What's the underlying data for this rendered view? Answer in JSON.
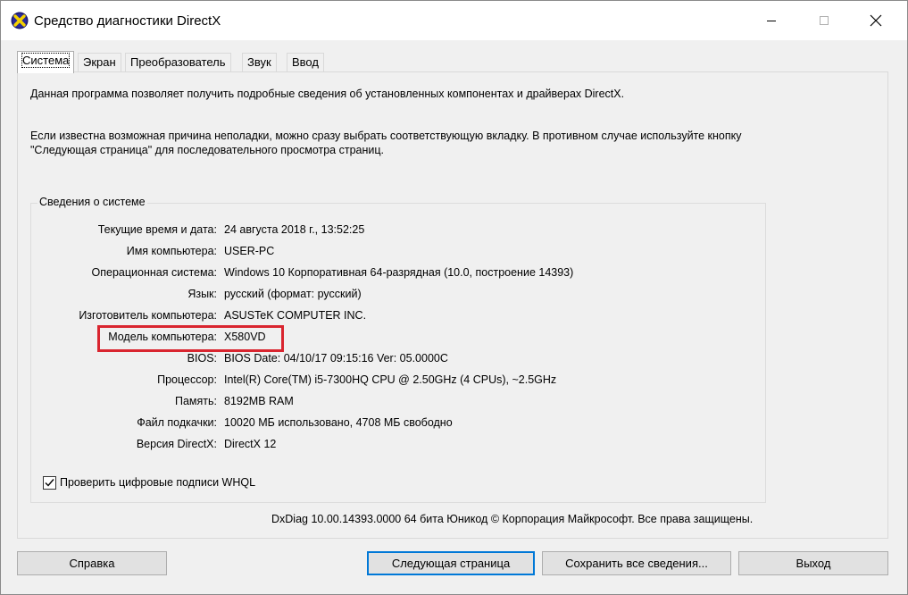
{
  "window": {
    "title": "Средство диагностики DirectX",
    "icon": "directx-icon",
    "controls": {
      "minimize": "minimize-icon",
      "maximize": "maximize-icon",
      "close": "close-icon"
    }
  },
  "tabs": [
    {
      "label": "Система",
      "active": true
    },
    {
      "label": "Экран",
      "active": false
    },
    {
      "label": "Преобразователь",
      "active": false
    },
    {
      "label": "Звук",
      "active": false
    },
    {
      "label": "Ввод",
      "active": false
    }
  ],
  "intro": {
    "line1": "Данная программа позволяет получить подробные сведения об установленных компонентах и драйверах DirectX.",
    "line2": "Если известна возможная причина неполадки, можно сразу выбрать соответствующую вкладку. В противном случае используйте кнопку \"Следующая страница\" для последовательного просмотра страниц."
  },
  "system_info": {
    "group_title": "Сведения о системе",
    "rows": [
      {
        "label": "Текущие время и дата:",
        "value": "24 августа 2018 г., 13:52:25"
      },
      {
        "label": "Имя компьютера:",
        "value": "USER-PC"
      },
      {
        "label": "Операционная система:",
        "value": "Windows 10 Корпоративная 64-разрядная (10.0, построение 14393)"
      },
      {
        "label": "Язык:",
        "value": "русский (формат: русский)"
      },
      {
        "label": "Изготовитель компьютера:",
        "value": "ASUSTeK COMPUTER INC."
      },
      {
        "label": "Модель компьютера:",
        "value": "X580VD"
      },
      {
        "label": "BIOS:",
        "value": "BIOS Date: 04/10/17 09:15:16 Ver: 05.0000C"
      },
      {
        "label": "Процессор:",
        "value": "Intel(R) Core(TM) i5-7300HQ CPU @ 2.50GHz (4 CPUs), ~2.5GHz"
      },
      {
        "label": "Память:",
        "value": "8192MB RAM"
      },
      {
        "label": "Файл подкачки:",
        "value": "10020 МБ использовано, 4708 МБ свободно"
      },
      {
        "label": "Версия DirectX:",
        "value": "DirectX 12"
      }
    ]
  },
  "whql_checkbox": {
    "label": "Проверить цифровые подписи WHQL",
    "checked": true
  },
  "footer": "DxDiag 10.00.14393.0000 64 бита Юникод © Корпорация Майкрософт. Все права защищены.",
  "buttons": {
    "help": "Справка",
    "next": "Следующая страница",
    "save": "Сохранить все сведения...",
    "exit": "Выход"
  },
  "colors": {
    "highlight": "#d9252f",
    "default_button_border": "#0078d7"
  }
}
